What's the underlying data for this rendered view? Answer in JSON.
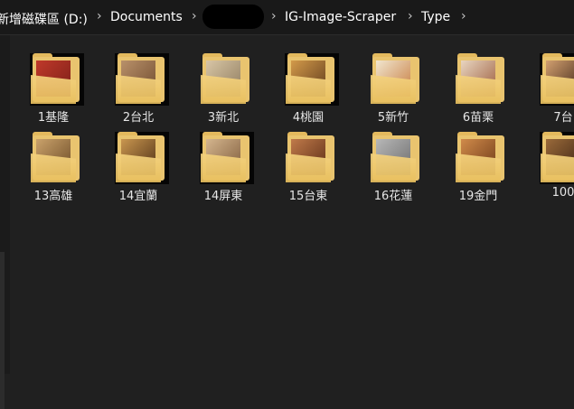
{
  "breadcrumb": {
    "items": [
      "新增磁碟區 (D:)",
      "Documents",
      "IG-Image-Scraper",
      "Type"
    ]
  },
  "folders": [
    {
      "label": "1基隆",
      "photo": [
        "#c0392b",
        "#7a1f17"
      ]
    },
    {
      "label": "2台北",
      "photo": [
        "#b9916a",
        "#6e4a2e"
      ]
    },
    {
      "label": "3新北",
      "photo": [
        "#d9c6a6",
        "#8c7a5c"
      ]
    },
    {
      "label": "4桃園",
      "photo": [
        "#d39a4a",
        "#5e3a1c"
      ]
    },
    {
      "label": "5新竹",
      "photo": [
        "#f1e6cf",
        "#c67a3d"
      ]
    },
    {
      "label": "6苗栗",
      "photo": [
        "#e8d5c0",
        "#9a5a3a"
      ]
    },
    {
      "label": "7台",
      "photo": [
        "#d2a070",
        "#3b2214"
      ]
    },
    {
      "label": "13高雄",
      "photo": [
        "#caa26b",
        "#6b4a25"
      ]
    },
    {
      "label": "14宜蘭",
      "photo": [
        "#c9964f",
        "#4d2f15"
      ]
    },
    {
      "label": "14屏東",
      "photo": [
        "#d4b58e",
        "#7d5a39"
      ]
    },
    {
      "label": "15台東",
      "photo": [
        "#c07a4a",
        "#5a2c15"
      ]
    },
    {
      "label": "16花蓮",
      "photo": [
        "#b8b8b8",
        "#6b6b6b"
      ]
    },
    {
      "label": "19金門",
      "photo": [
        "#d08a4a",
        "#6d3a18"
      ]
    },
    {
      "label": "100",
      "photo": [
        "#9a6a3a",
        "#3a2212"
      ]
    }
  ]
}
